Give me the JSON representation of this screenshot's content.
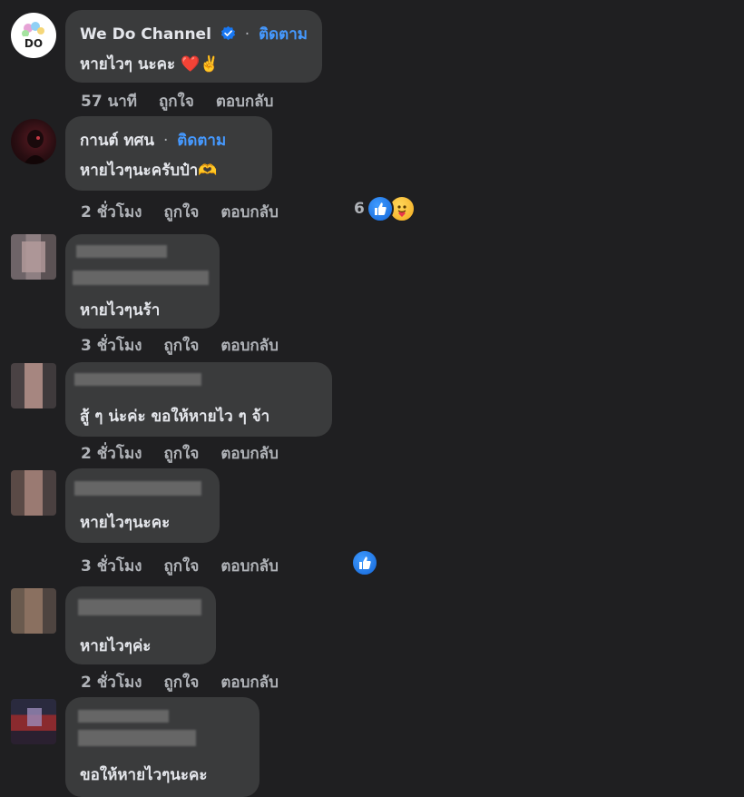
{
  "comments": [
    {
      "name": "We Do Channel",
      "verified": true,
      "follow": "ติดตาม",
      "text": "หายไวๆ นะคะ ❤️✌️",
      "time": "57 นาที",
      "like": "ถูกใจ",
      "reply": "ตอบกลับ",
      "avatar_label": "DO"
    },
    {
      "name": "กานต์ ทศน",
      "follow": "ติดตาม",
      "text": "หายไวๆนะครับป๋า🫶",
      "time": "2 ชั่วโมง",
      "like": "ถูกใจ",
      "reply": "ตอบกลับ",
      "reaction_count": "6"
    },
    {
      "text": "หายไวๆนร้า",
      "time": "3 ชั่วโมง",
      "like": "ถูกใจ",
      "reply": "ตอบกลับ"
    },
    {
      "text": "สู้ ๆ น่ะค่ะ ขอให้หายไว ๆ จ้า",
      "time": "2 ชั่วโมง",
      "like": "ถูกใจ",
      "reply": "ตอบกลับ"
    },
    {
      "text": "หายไวๆนะคะ",
      "time": "3 ชั่วโมง",
      "like": "ถูกใจ",
      "reply": "ตอบกลับ"
    },
    {
      "text": "หายไวๆค่ะ",
      "time": "2 ชั่วโมง",
      "like": "ถูกใจ",
      "reply": "ตอบกลับ"
    },
    {
      "text": "ขอให้หายไวๆนะคะ"
    }
  ],
  "colors": {
    "background": "#1f1f21",
    "bubble": "#3a3b3c",
    "follow_link": "#4599ff",
    "like_blue": "#1877f2"
  },
  "icons": [
    "verified-badge-icon",
    "like-reaction-icon",
    "care-reaction-icon"
  ]
}
